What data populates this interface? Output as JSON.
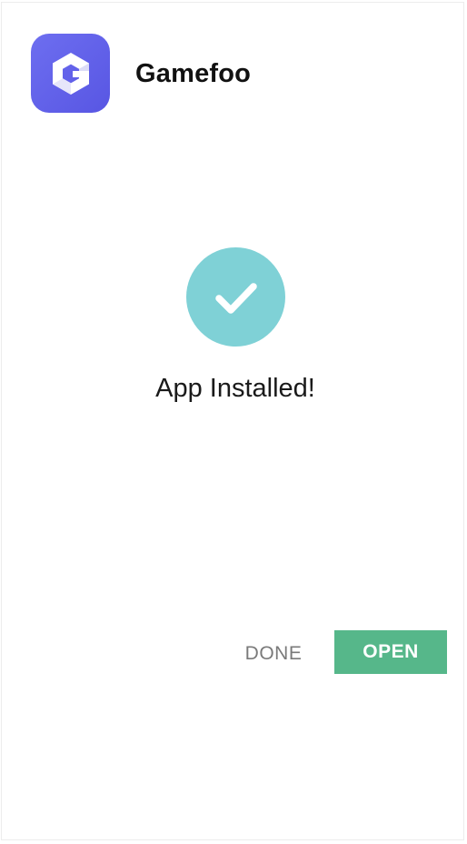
{
  "app": {
    "name": "Gamefoo",
    "icon": "gamefoo-logo-icon",
    "icon_color": "#5f5fe8"
  },
  "status": {
    "icon": "checkmark-icon",
    "icon_color": "#7fd1d6",
    "message": "App Installed!"
  },
  "actions": {
    "done_label": "DONE",
    "open_label": "OPEN",
    "open_color": "#56b78a"
  }
}
